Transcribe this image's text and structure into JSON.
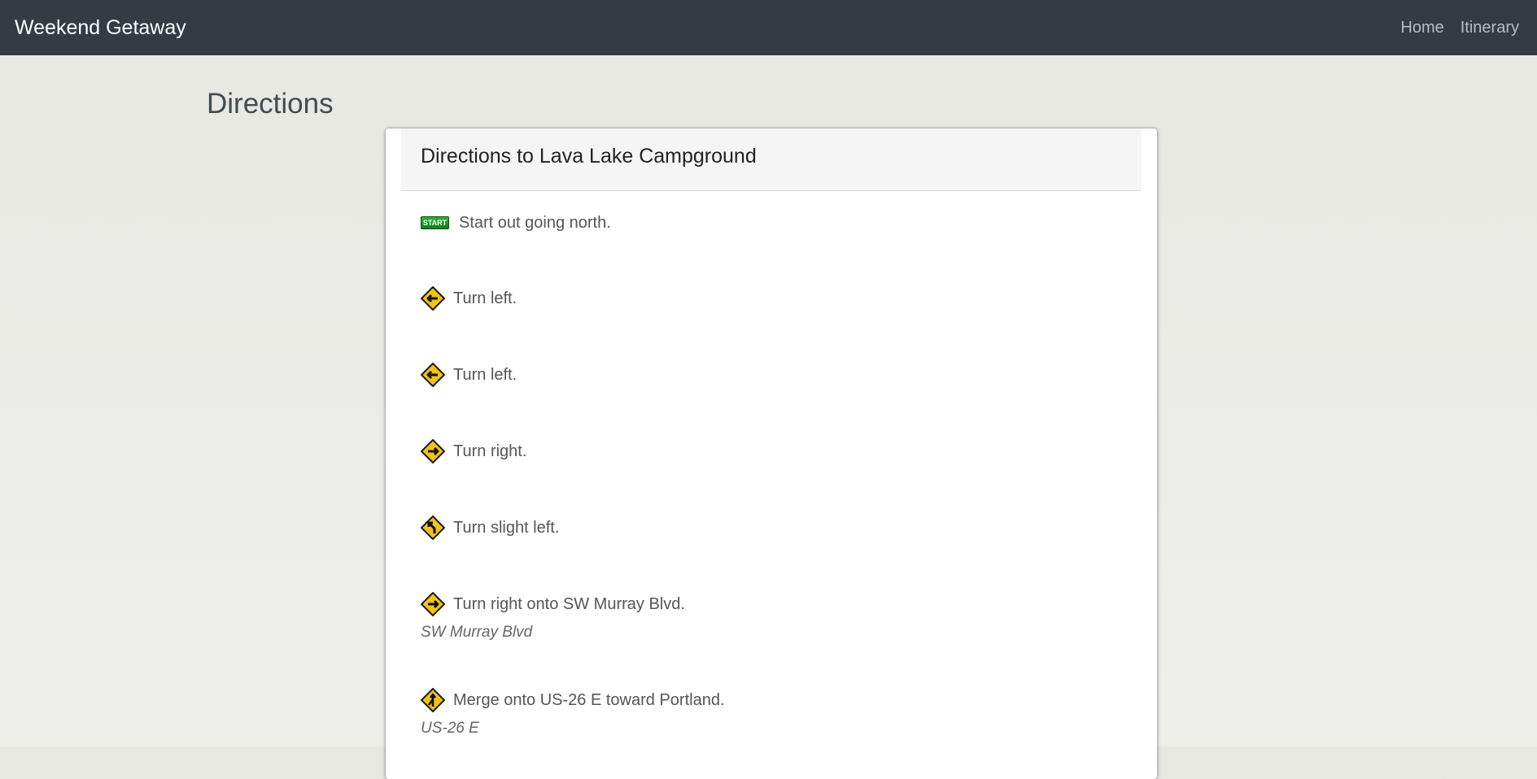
{
  "navbar": {
    "brand": "Weekend Getaway",
    "links": [
      "Home",
      "Itinerary"
    ]
  },
  "page": {
    "title": "Directions"
  },
  "panel": {
    "title": "Directions to Lava Lake Campground"
  },
  "icons": {
    "start_label": "START"
  },
  "steps": [
    {
      "icon": "start-icon",
      "text": "Start out going north.",
      "road": ""
    },
    {
      "icon": "turn-left-icon",
      "text": "Turn left.",
      "road": ""
    },
    {
      "icon": "turn-left-icon",
      "text": "Turn left.",
      "road": ""
    },
    {
      "icon": "turn-right-icon",
      "text": "Turn right.",
      "road": ""
    },
    {
      "icon": "turn-slight-left-icon",
      "text": "Turn slight left.",
      "road": ""
    },
    {
      "icon": "turn-right-icon",
      "text": "Turn right onto SW Murray Blvd.",
      "road": "SW Murray Blvd"
    },
    {
      "icon": "merge-icon",
      "text": "Merge onto US-26 E toward Portland.",
      "road": "US-26 E"
    }
  ],
  "colors": {
    "navbar": "#363b43",
    "sign_fill": "#f2c21b",
    "start_green": "#1f9a2b"
  }
}
